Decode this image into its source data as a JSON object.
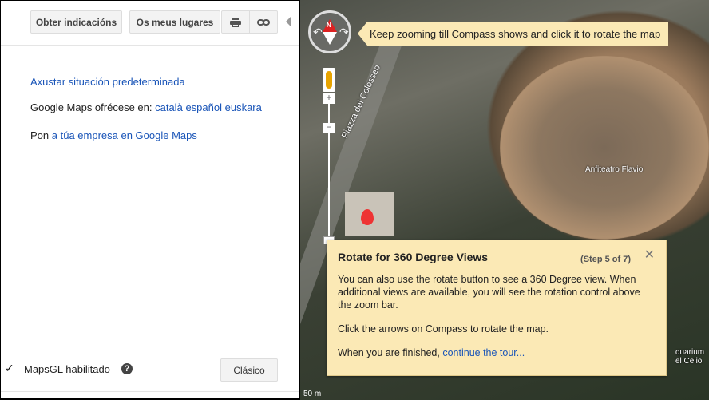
{
  "toolbar": {
    "directions_label": "Obter indicacións",
    "my_places_label": "Os meus lugares"
  },
  "panel": {
    "default_location_link": "Axustar situación predeterminada",
    "languages_prefix": "Google Maps ofrécese en:",
    "languages": [
      "català",
      "español",
      "euskara"
    ],
    "business_prefix": "Pon",
    "business_link": "a túa empresa en Google Maps",
    "mapsgl_label": "MapsGL habilitado",
    "classic_label": "Clásico"
  },
  "map": {
    "street_label": "Piazza del Colosseo",
    "poi_label": "Anfiteatro Flavio",
    "poi2_label_line1": "quarium",
    "poi2_label_line2": "el Celio",
    "scale_label": "50 m",
    "compass_north": "N"
  },
  "compass_tip": {
    "text": "Keep zooming till Compass shows and click it to rotate the map"
  },
  "tour": {
    "title": "Rotate for 360 Degree Views",
    "step": "(Step 5 of 7)",
    "para1": "You can also use the rotate button to see a 360 Degree view. When additional views are available, you will see the rotation control above the zoom bar.",
    "para2": "Click the arrows on Compass to rotate the map.",
    "para3_prefix": "When you are finished,",
    "continue_link": "continue the tour..."
  }
}
